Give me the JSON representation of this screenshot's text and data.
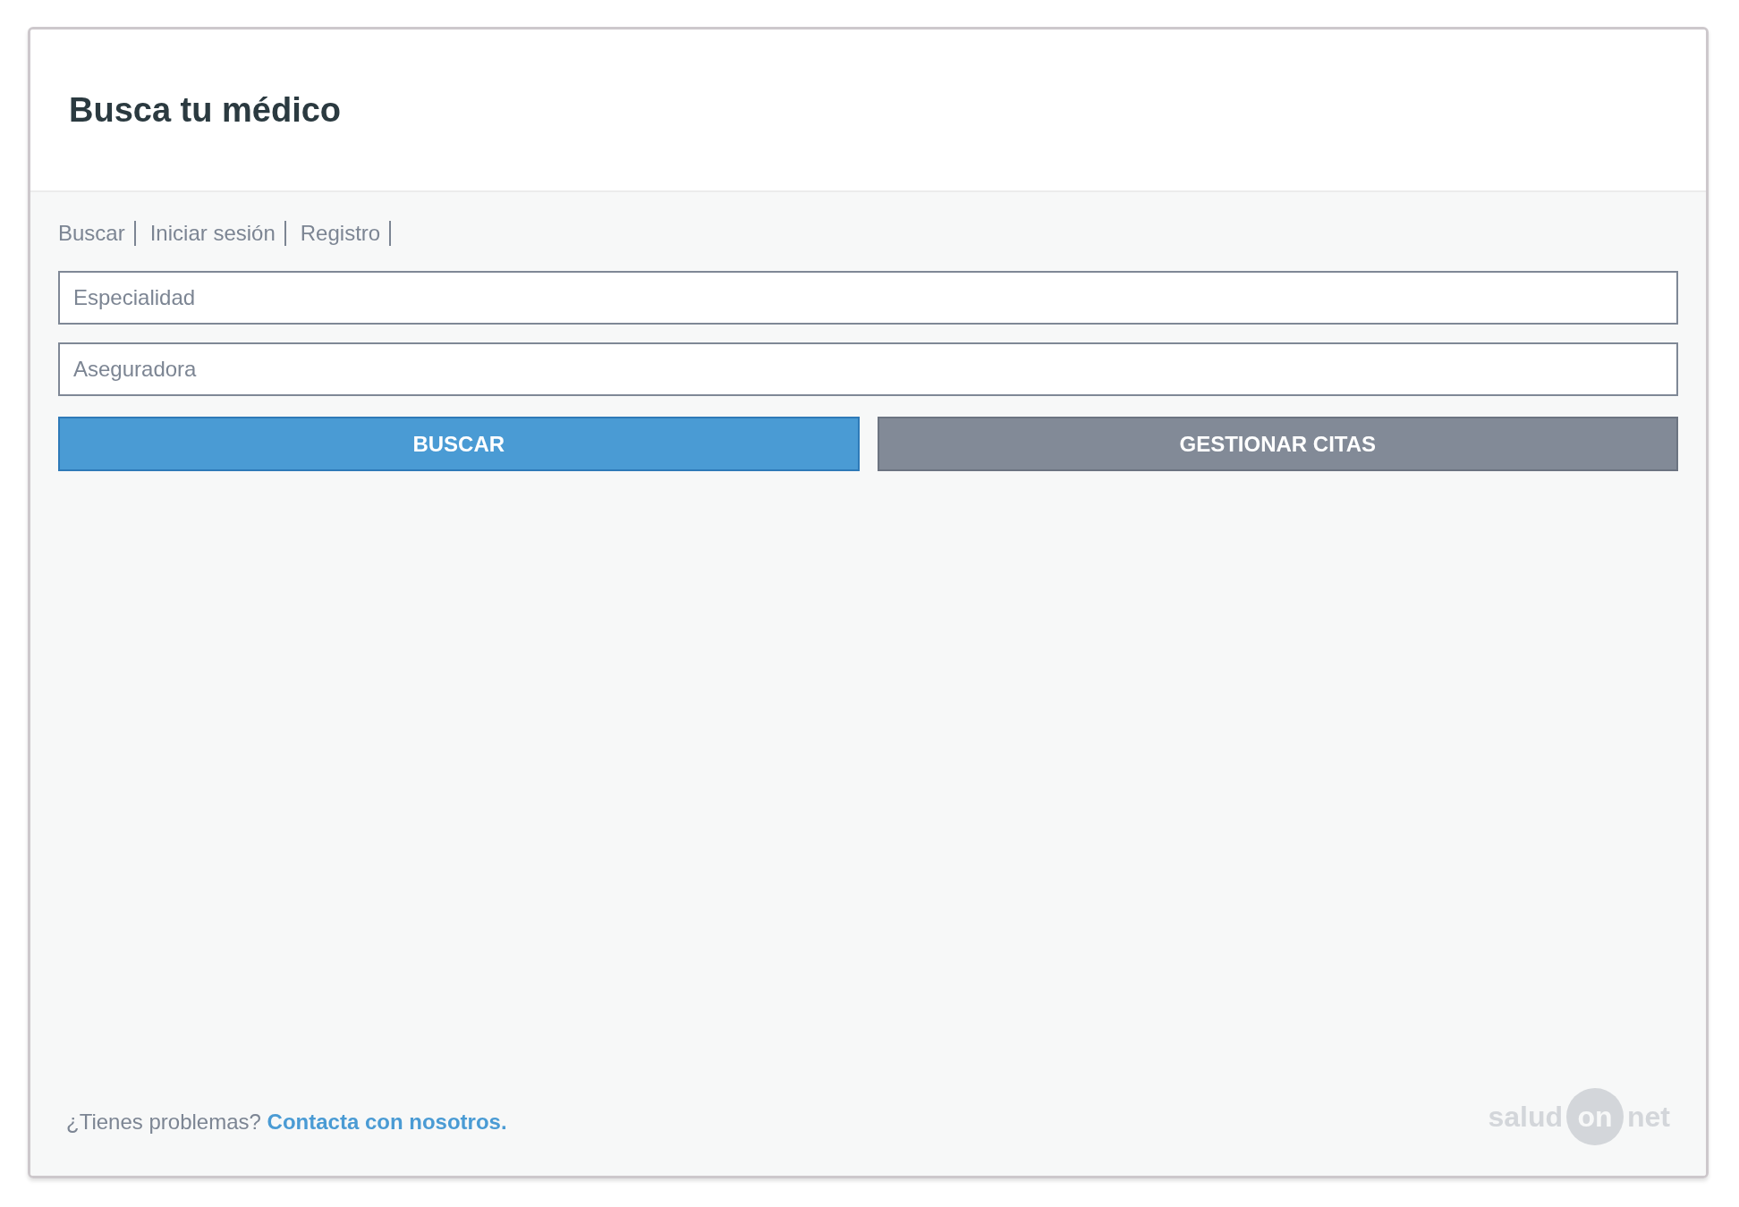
{
  "header": {
    "title": "Busca tu médico"
  },
  "nav": [
    "Buscar",
    "Iniciar sesión",
    "Registro"
  ],
  "fields": [
    {
      "placeholder": "Especialidad"
    },
    {
      "placeholder": "Aseguradora"
    }
  ],
  "buttons": [
    {
      "label": "BUSCAR",
      "kind": "primary"
    },
    {
      "label": "GESTIONAR CITAS",
      "kind": "secondary"
    }
  ],
  "footer": {
    "text": "¿Tienes problemas?",
    "link": "Contacta con nosotros.",
    "logo": [
      "salud",
      "on",
      "net"
    ]
  }
}
